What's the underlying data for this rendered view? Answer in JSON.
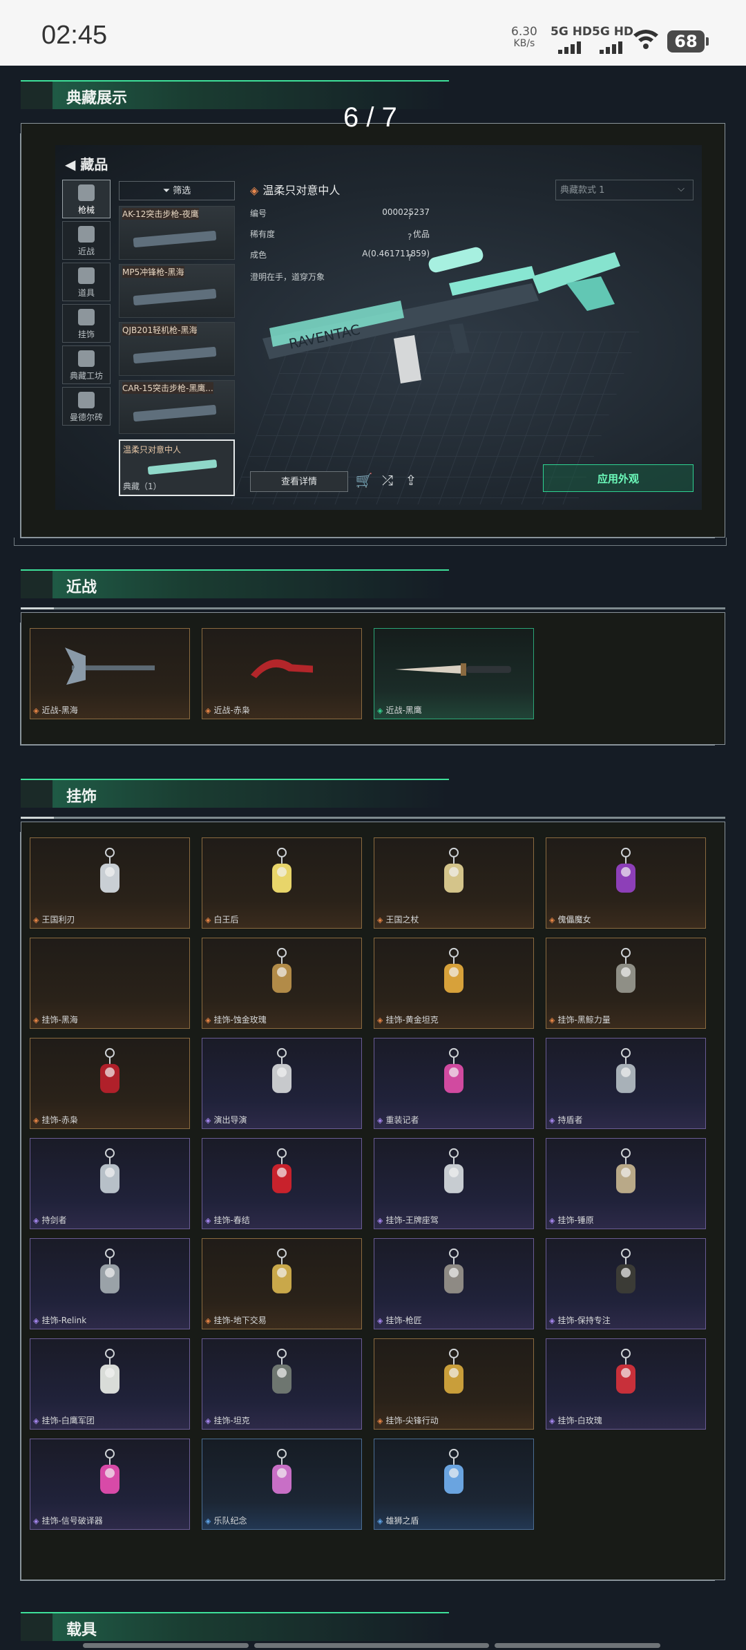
{
  "status_bar": {
    "time": "02:45",
    "net_speed": "6.30",
    "net_unit": "KB/s",
    "sim1": "5G HD",
    "sim2": "5G HD",
    "battery": "68"
  },
  "sections": {
    "collection": "典藏展示",
    "melee": "近战",
    "charms": "挂饰",
    "vehicles": "载具"
  },
  "carousel": {
    "counter": "6 / 7"
  },
  "screenshot": {
    "back_label": "藏品",
    "tabs": [
      "枪械",
      "近战",
      "道具",
      "挂饰",
      "典藏工坊",
      "曼德尔砖"
    ],
    "filter_label": "筛选",
    "list": [
      "AK-12突击步枪-夜鹰",
      "MP5冲锋枪-黑海",
      "QJB201轻机枪-黑海",
      "CAR-15突击步枪-黑鹰..."
    ],
    "selected": {
      "title": "温柔只对意中人",
      "count": "典藏（1）"
    },
    "item_name": "温柔只对意中人",
    "props": [
      {
        "k": "编号",
        "v": "000025237",
        "q": "?"
      },
      {
        "k": "稀有度",
        "v": "优品",
        "q": "?"
      },
      {
        "k": "成色",
        "v": "A(0.461711859)",
        "q": "?"
      }
    ],
    "description": "澄明在手，道穿万象",
    "style_select": "典藏款式 1",
    "detail_button": "查看详情",
    "apply_button": "应用外观",
    "gun_text": "RAVENTAC"
  },
  "melee": [
    {
      "label": "近战-黑海",
      "rarity": "gold",
      "icon": "axe-icon"
    },
    {
      "label": "近战-赤枭",
      "rarity": "gold",
      "icon": "karambit-icon"
    },
    {
      "label": "近战-黑鹰",
      "rarity": "green",
      "icon": "dagger-icon"
    }
  ],
  "charms": [
    {
      "label": "王国利刃",
      "rarity": "gold",
      "icon": "knight-figure-icon"
    },
    {
      "label": "白王后",
      "rarity": "gold",
      "icon": "queen-figure-icon"
    },
    {
      "label": "王国之杖",
      "rarity": "gold",
      "icon": "king-figure-icon"
    },
    {
      "label": "傀儡魔女",
      "rarity": "gold",
      "icon": "witch-figure-icon"
    },
    {
      "label": "挂饰-黑海",
      "rarity": "gold",
      "icon": "empty-icon"
    },
    {
      "label": "挂饰-蚀金玫瑰",
      "rarity": "gold",
      "icon": "rose-badge-icon"
    },
    {
      "label": "挂饰-黄金坦克",
      "rarity": "gold",
      "icon": "gold-tank-icon"
    },
    {
      "label": "挂饰-黑鲸力量",
      "rarity": "gold",
      "icon": "statue-icon"
    },
    {
      "label": "挂饰-赤枭",
      "rarity": "gold",
      "icon": "red-blade-icon"
    },
    {
      "label": "演出导演",
      "rarity": "purple",
      "icon": "director-figure-icon"
    },
    {
      "label": "重装记者",
      "rarity": "purple",
      "icon": "reporter-figure-icon"
    },
    {
      "label": "持盾者",
      "rarity": "purple",
      "icon": "shield-bearer-icon"
    },
    {
      "label": "持剑者",
      "rarity": "purple",
      "icon": "sword-bearer-icon"
    },
    {
      "label": "挂饰-春结",
      "rarity": "purple",
      "icon": "chinese-knot-icon"
    },
    {
      "label": "挂饰-王牌座驾",
      "rarity": "purple",
      "icon": "jet-icon"
    },
    {
      "label": "挂饰-锤原",
      "rarity": "purple",
      "icon": "hammer-icon"
    },
    {
      "label": "挂饰-Relink",
      "rarity": "purple",
      "icon": "knot-ring-icon"
    },
    {
      "label": "挂饰-地下交易",
      "rarity": "gold",
      "icon": "z-badge-icon"
    },
    {
      "label": "挂饰-枪匠",
      "rarity": "purple",
      "icon": "gear-block-icon"
    },
    {
      "label": "挂饰-保持专注",
      "rarity": "purple",
      "icon": "tag-icon"
    },
    {
      "label": "挂饰-白鹰军团",
      "rarity": "purple",
      "icon": "winged-sword-icon"
    },
    {
      "label": "挂饰-坦克",
      "rarity": "purple",
      "icon": "tank-icon"
    },
    {
      "label": "挂饰-尖锋行动",
      "rarity": "gold",
      "icon": "n-badge-icon"
    },
    {
      "label": "挂饰-白玫瑰",
      "rarity": "purple",
      "icon": "red-rose-icon"
    },
    {
      "label": "挂饰-信号破译器",
      "rarity": "purple",
      "icon": "decoder-icon"
    },
    {
      "label": "乐队纪念",
      "rarity": "blue",
      "icon": "band-badge-icon"
    },
    {
      "label": "雄狮之盾",
      "rarity": "blue",
      "icon": "lion-shield-icon"
    }
  ],
  "colors": {
    "accent": "#3ee19a",
    "gold": "#e88646",
    "purple": "#a788f0",
    "blue": "#5fa4e8"
  }
}
